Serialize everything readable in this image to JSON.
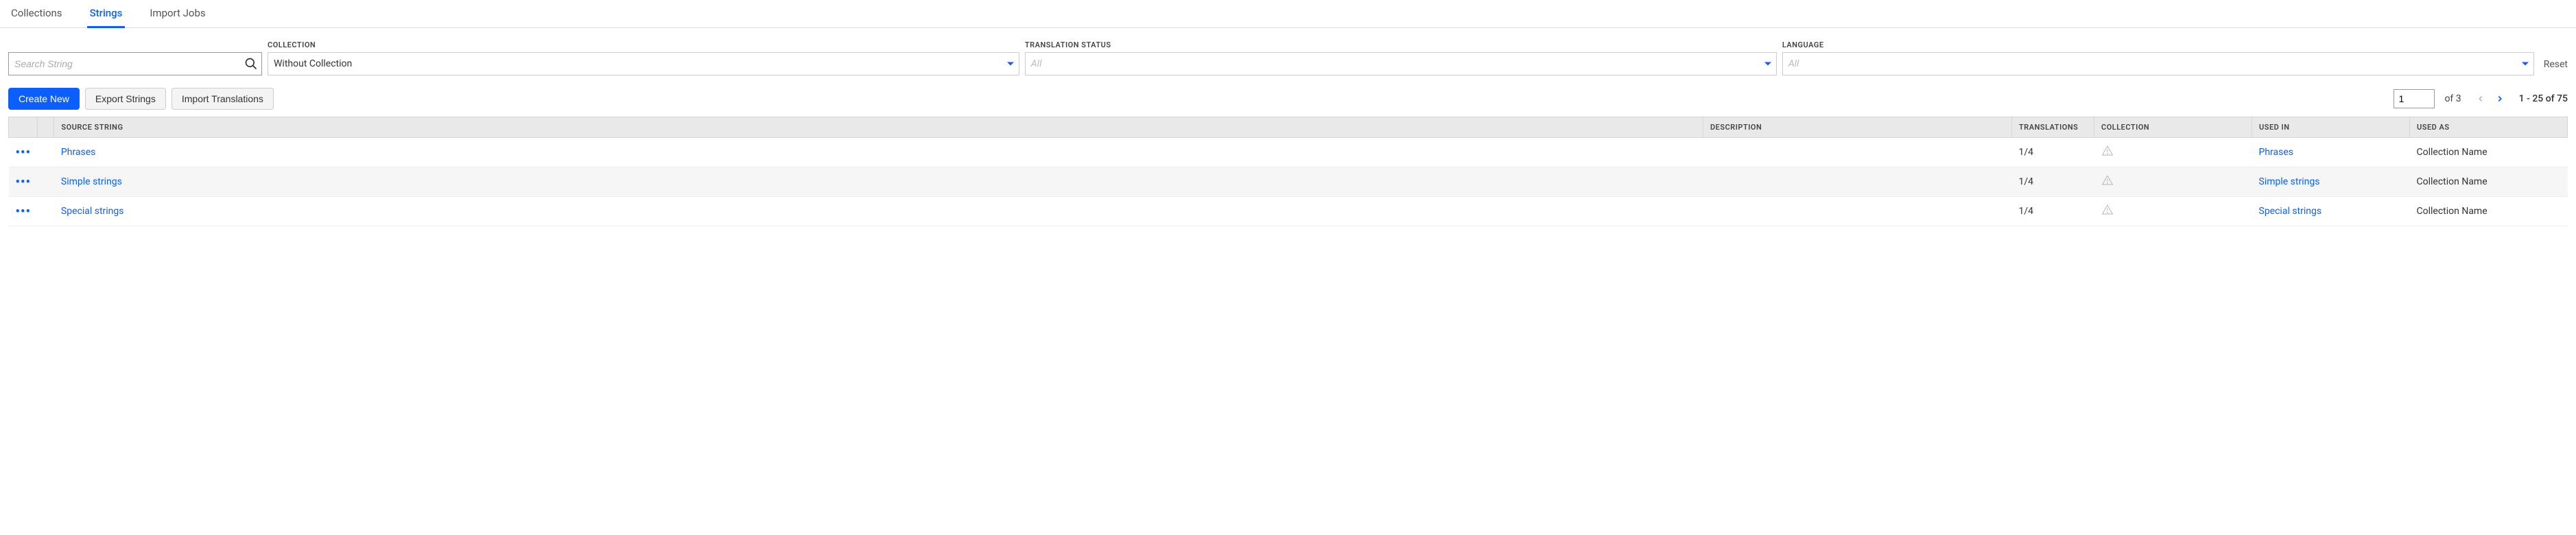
{
  "tabs": {
    "collections": "Collections",
    "strings": "Strings",
    "import_jobs": "Import Jobs"
  },
  "filters": {
    "search": {
      "placeholder": "Search String"
    },
    "collection": {
      "label": "COLLECTION",
      "value": "Without Collection"
    },
    "translation_status": {
      "label": "TRANSLATION STATUS",
      "placeholder": "All"
    },
    "language": {
      "label": "LANGUAGE",
      "placeholder": "All"
    },
    "reset": "Reset"
  },
  "actions": {
    "create": "Create New",
    "export": "Export Strings",
    "import": "Import Translations"
  },
  "pager": {
    "page": "1",
    "of_label": "of 3",
    "range": "1 - 25 of 75"
  },
  "table": {
    "headers": {
      "source": "SOURCE STRING",
      "description": "DESCRIPTION",
      "translations": "TRANSLATIONS",
      "collection": "COLLECTION",
      "used_in": "USED IN",
      "used_as": "USED AS"
    },
    "rows": [
      {
        "source": "Phrases",
        "description": "",
        "translations": "1/4",
        "collection_warn": true,
        "used_in": "Phrases",
        "used_as": "Collection Name"
      },
      {
        "source": "Simple strings",
        "description": "",
        "translations": "1/4",
        "collection_warn": true,
        "used_in": "Simple strings",
        "used_as": "Collection Name"
      },
      {
        "source": "Special strings",
        "description": "",
        "translations": "1/4",
        "collection_warn": true,
        "used_in": "Special strings",
        "used_as": "Collection Name"
      }
    ]
  }
}
